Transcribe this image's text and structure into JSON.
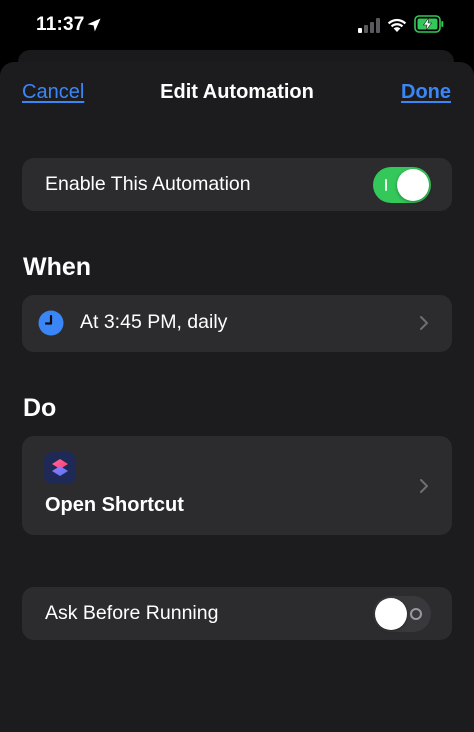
{
  "status_bar": {
    "time": "11:37",
    "icons": [
      "location-arrow-icon",
      "cellular-signal-icon",
      "wifi-icon",
      "battery-charging-icon"
    ]
  },
  "nav": {
    "cancel_label": "Cancel",
    "title": "Edit Automation",
    "done_label": "Done"
  },
  "enable": {
    "label": "Enable This Automation",
    "enabled": true
  },
  "when": {
    "header": "When",
    "trigger_label": "At 3:45 PM, daily",
    "icon": "clock-icon"
  },
  "do": {
    "header": "Do",
    "action_name": "Open Shortcut",
    "icon": "shortcuts-app-icon"
  },
  "ask_before_running": {
    "label": "Ask Before Running",
    "enabled": false
  },
  "colors": {
    "accent": "#3b86f7",
    "toggle_on": "#34c759",
    "card": "#2c2c2e",
    "sheet": "#1c1c1e"
  }
}
